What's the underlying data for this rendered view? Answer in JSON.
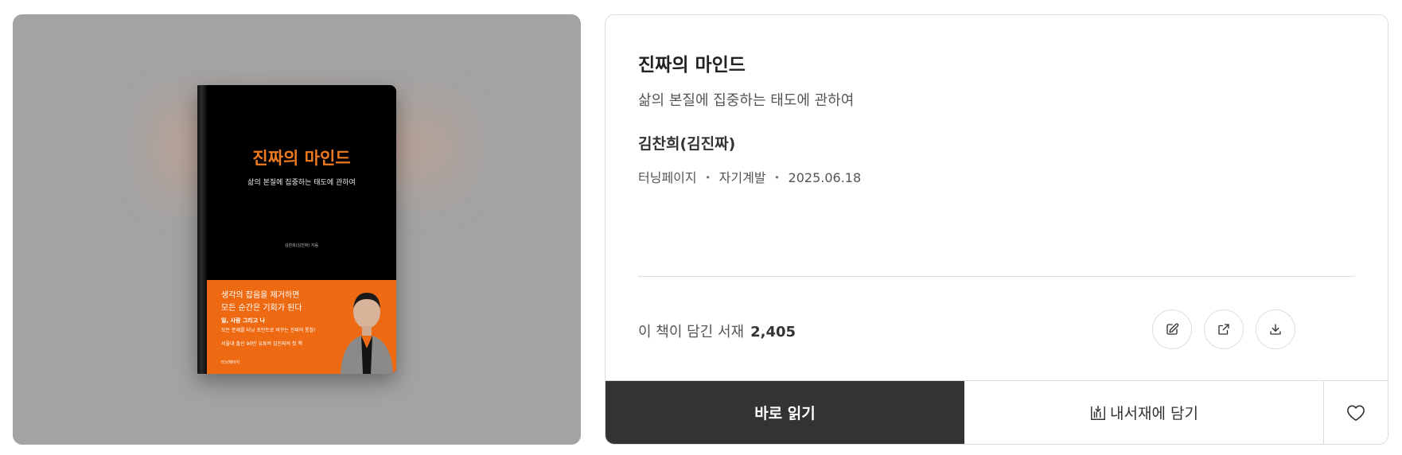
{
  "cover": {
    "title": "진짜의 마인드",
    "subtitle": "삶의 본질에 집중하는 태도에 관하여",
    "author": "김찬희(김진짜) 지음",
    "band_line1": "생각의 잡음을 제거하면",
    "band_line2": "모든 순간은 기회가 된다",
    "band_line3": "일, 사람 그리고 나",
    "band_line4": "모든 문제를 터닝 포인트로 바꾸는 진짜의 통찰!",
    "band_line5": "서울대 출신 90만 유튜버 김진짜의 첫 책",
    "publisher_logo": "터닝페이지"
  },
  "book": {
    "title": "진짜의 마인드",
    "subtitle": "삶의 본질에 집중하는 태도에 관하여",
    "author": "김찬희(김진짜)",
    "publisher": "터닝페이지",
    "category": "자기계발",
    "date": "2025.06.18",
    "separator": "・"
  },
  "shelf": {
    "label": "이 책이 담긴 서재",
    "count": "2,405"
  },
  "actions": {
    "read_label": "바로 읽기",
    "add_label": "내서재에 담기"
  },
  "icons": {
    "edit": "edit-icon",
    "share": "share-icon",
    "download": "download-icon",
    "bookshelf": "bookshelf-icon",
    "like": "heart-icon"
  },
  "colors": {
    "cover_bg": "#a3a3a3",
    "book_orange": "#ee6a12",
    "read_button": "#333333"
  }
}
